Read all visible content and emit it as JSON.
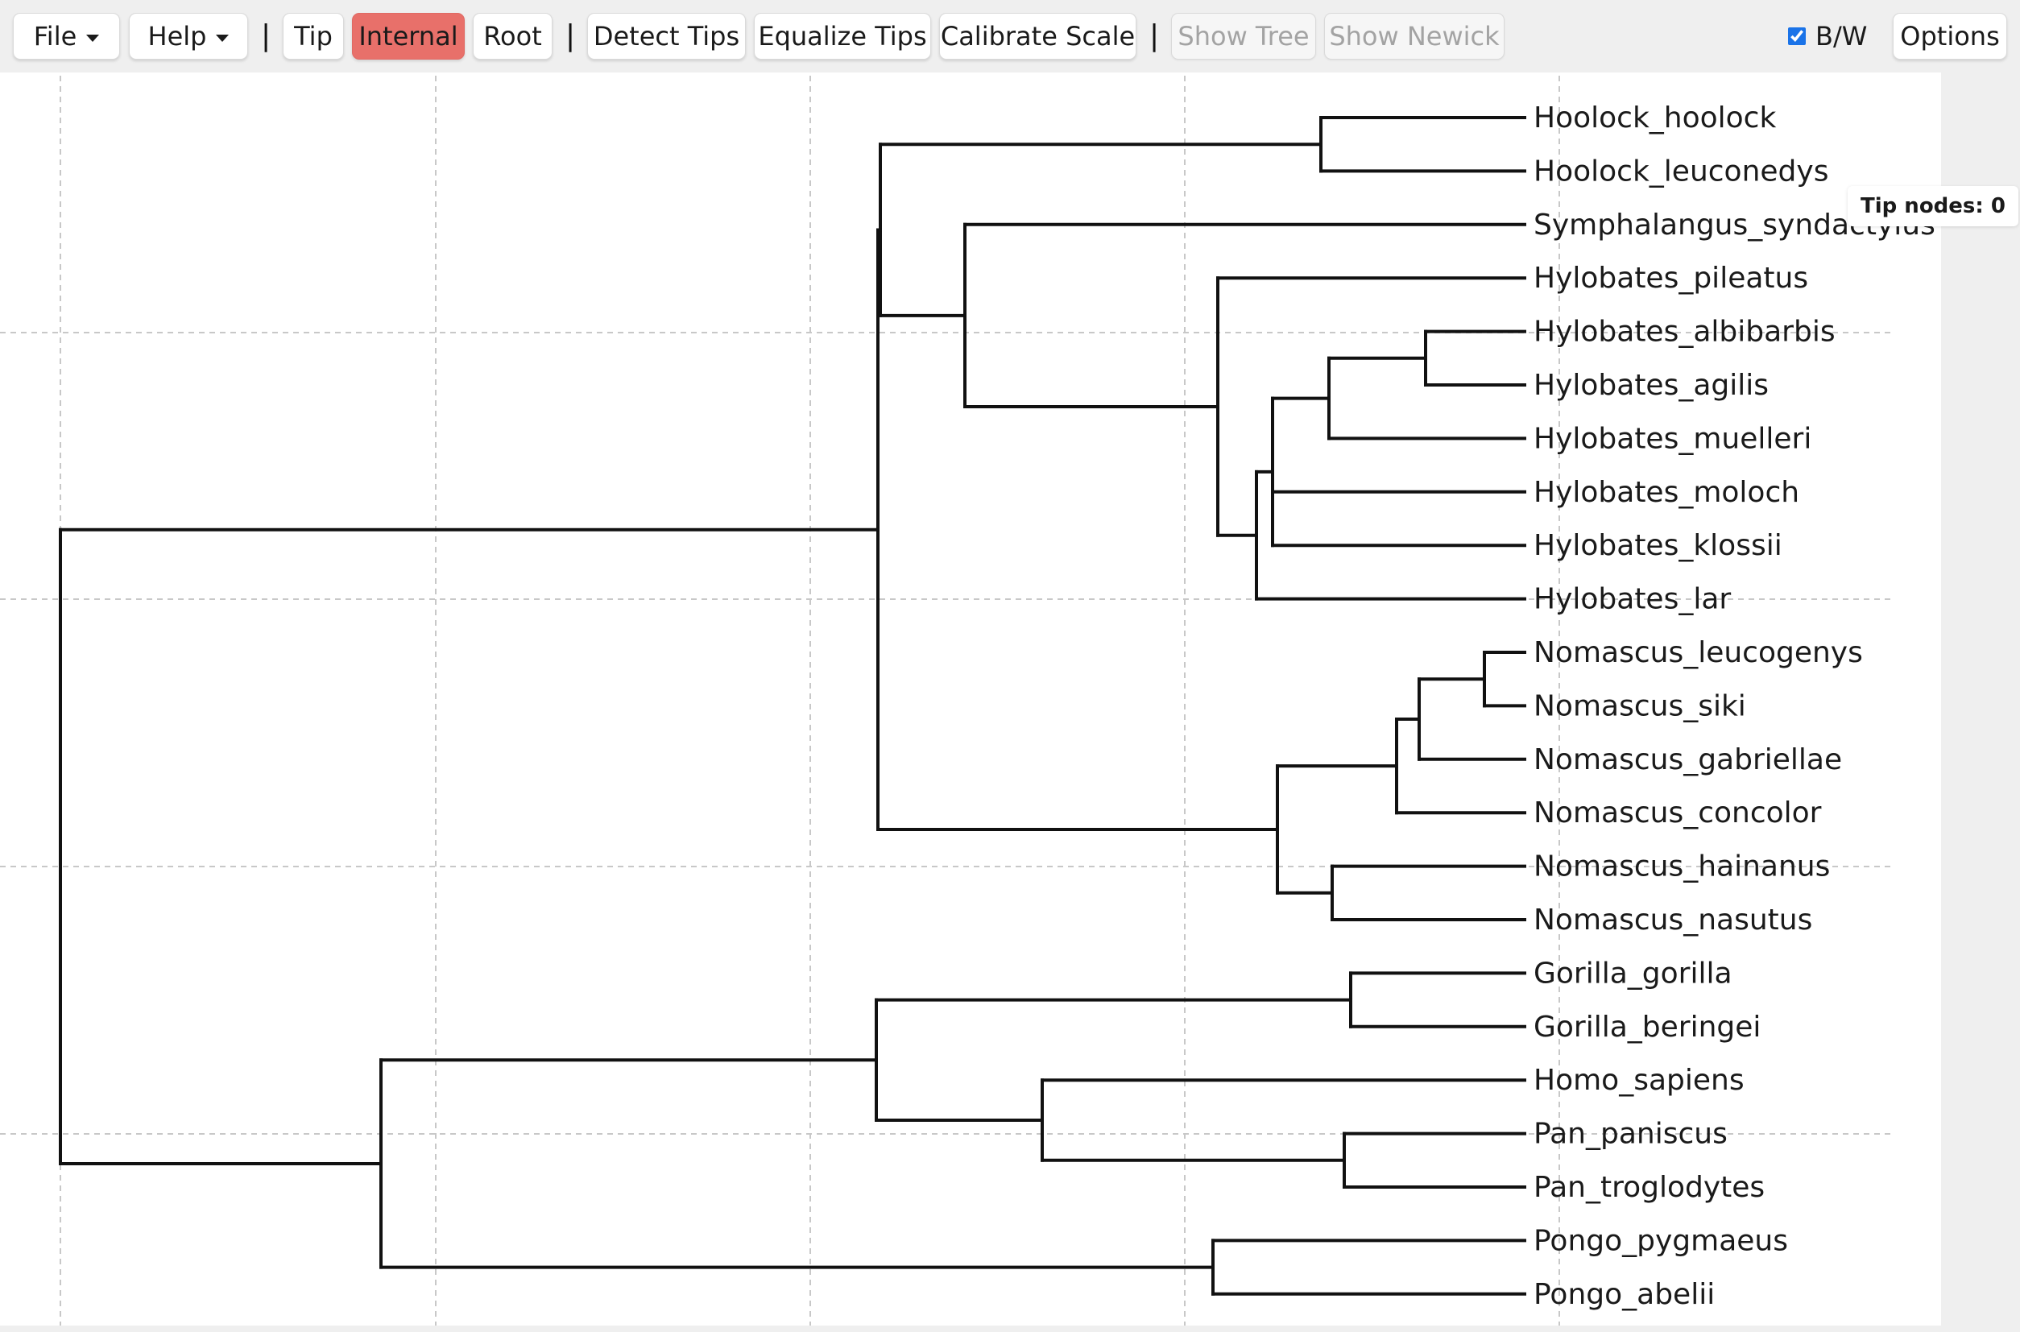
{
  "toolbar": {
    "file": "File",
    "help": "Help",
    "sep": "|",
    "tip": "Tip",
    "internal": "Internal",
    "root": "Root",
    "detect_tips": "Detect Tips",
    "equalize_tips": "Equalize Tips",
    "calibrate_scale": "Calibrate Scale",
    "show_tree": "Show Tree",
    "show_newick": "Show Newick",
    "bw_label": "B/W",
    "bw_checked": true,
    "options": "Options"
  },
  "tip_counter": {
    "label": "Tip nodes: 0"
  },
  "colors": {
    "active_button": "#e8706a",
    "tree_line": "#111111",
    "grid_line": "#c8c8c8"
  },
  "tree": {
    "tips": [
      "Hoolock_hoolock",
      "Hoolock_leuconedys",
      "Symphalangus_syndactylus",
      "Hylobates_pileatus",
      "Hylobates_albibarbis",
      "Hylobates_agilis",
      "Hylobates_muelleri",
      "Hylobates_moloch",
      "Hylobates_klossii",
      "Hylobates_lar",
      "Nomascus_leucogenys",
      "Nomascus_siki",
      "Nomascus_gabriellae",
      "Nomascus_concolor",
      "Nomascus_hainanus",
      "Nomascus_nasutus",
      "Gorilla_gorilla",
      "Gorilla_beringei",
      "Homo_sapiens",
      "Pan_paniscus",
      "Pan_troglodytes",
      "Pongo_pygmaeus",
      "Pongo_abelii"
    ]
  }
}
